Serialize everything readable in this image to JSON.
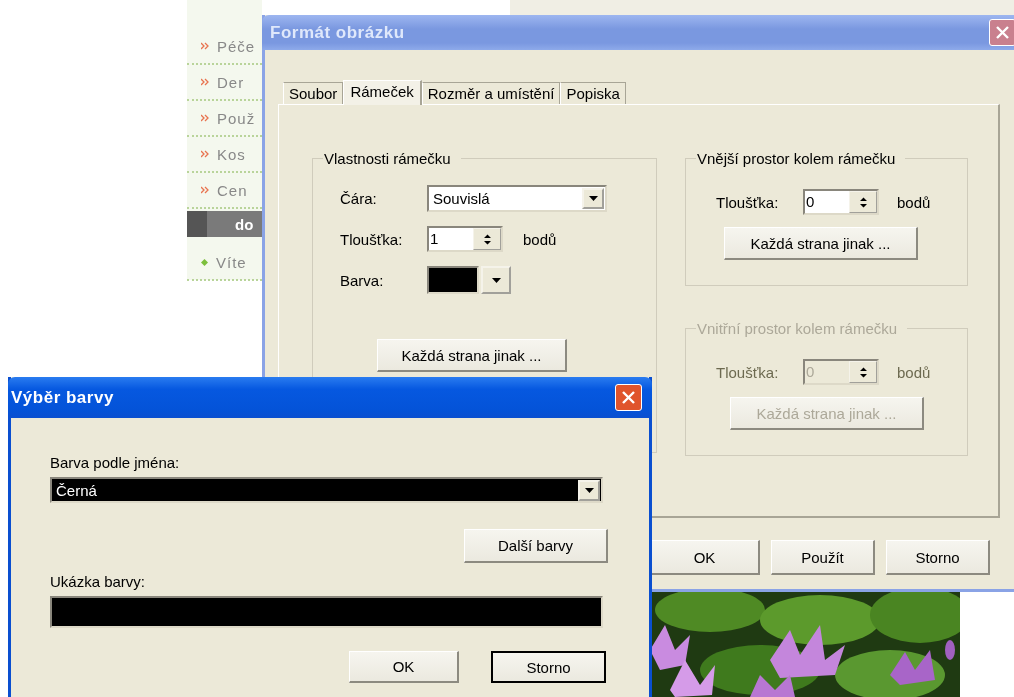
{
  "background_page": {
    "sidebar_items": [
      {
        "label": "Péče",
        "kind": "link"
      },
      {
        "label": "Der",
        "kind": "link"
      },
      {
        "label": "Použ",
        "kind": "link"
      },
      {
        "label": "Kos",
        "kind": "link"
      },
      {
        "label": "Cen",
        "kind": "link"
      },
      {
        "label": "do",
        "kind": "header"
      },
      {
        "label": "Víte",
        "kind": "sublink"
      }
    ]
  },
  "format_dialog": {
    "title": "Formát obrázku",
    "tabs": [
      {
        "label": "Soubor",
        "selected": false
      },
      {
        "label": "Rámeček",
        "selected": true
      },
      {
        "label": "Rozměr a umístění",
        "selected": false
      },
      {
        "label": "Popiska",
        "selected": false
      }
    ],
    "line_properties": {
      "title": "Vlastnosti rámečku",
      "line_label": "Čára:",
      "line_value": "Souvislá",
      "thickness_label": "Tloušťka:",
      "thickness_value": "1",
      "unit": "bodů",
      "color_label": "Barva:",
      "color": "#000000",
      "button": "Každá strana jinak ..."
    },
    "outer_spacing": {
      "title": "Vnější prostor kolem rámečku",
      "thickness_label": "Tloušťka:",
      "thickness_value": "0",
      "unit": "bodů",
      "button": "Každá strana jinak ...",
      "disabled": false
    },
    "inner_spacing": {
      "title": "Vnitřní prostor kolem rámečku",
      "thickness_label": "Tloušťka:",
      "thickness_value": "0",
      "unit": "bodů",
      "button": "Každá strana jinak ...",
      "disabled": true
    },
    "buttons": [
      "OK",
      "Použít",
      "Storno"
    ]
  },
  "color_dialog": {
    "title": "Výběr barvy",
    "name_label": "Barva podle jména:",
    "name_value": "Černá",
    "more_button": "Další barvy",
    "preview_label": "Ukázka barvy:",
    "preview": {
      "color": "#000000"
    },
    "buttons": [
      {
        "label": "OK",
        "default": false
      },
      {
        "label": "Storno",
        "default": true
      }
    ]
  }
}
